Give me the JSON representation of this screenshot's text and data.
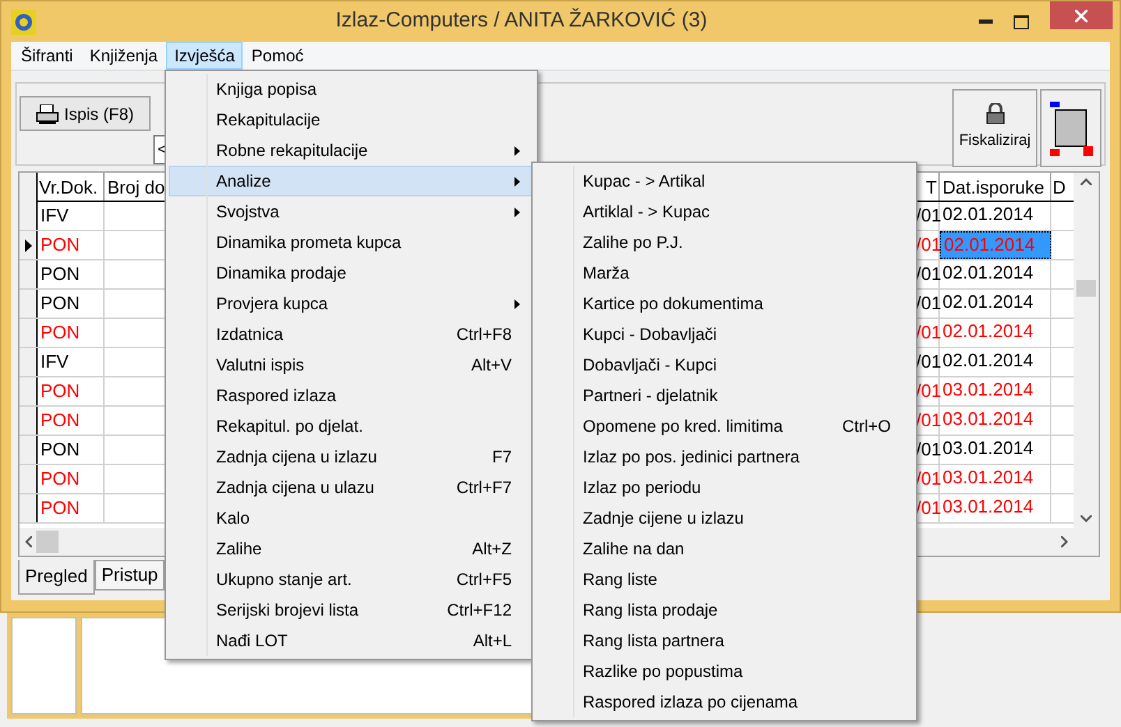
{
  "window": {
    "title": "Izlaz-Computers / ANITA ŽARKOVIĆ (3)"
  },
  "menu_bar": [
    {
      "label": "Šifranti",
      "selected": false
    },
    {
      "label": "Knjiženja",
      "selected": false
    },
    {
      "label": "Izvješća",
      "selected": true
    },
    {
      "label": "Pomoć",
      "selected": false
    }
  ],
  "toolbar": {
    "print_button": "Ispis (F8)",
    "field_value": "<",
    "fiscal_button": "Fiskaliziraj"
  },
  "table": {
    "columns": [
      "Vr.Dok.",
      "Broj do",
      "T",
      "Dat.isporuke",
      "D"
    ],
    "rows": [
      {
        "current": false,
        "red": false,
        "selected_date": false,
        "cells": [
          "IFV",
          "",
          "/01",
          "02.01.2014"
        ]
      },
      {
        "current": true,
        "red": true,
        "selected_date": true,
        "cells": [
          "PON",
          "",
          "/01",
          "02.01.2014"
        ]
      },
      {
        "current": false,
        "red": false,
        "selected_date": false,
        "cells": [
          "PON",
          "",
          "/01",
          "02.01.2014"
        ]
      },
      {
        "current": false,
        "red": false,
        "selected_date": false,
        "cells": [
          "PON",
          "",
          "/01",
          "02.01.2014"
        ]
      },
      {
        "current": false,
        "red": true,
        "selected_date": false,
        "cells": [
          "PON",
          "",
          "/01",
          "02.01.2014"
        ]
      },
      {
        "current": false,
        "red": false,
        "selected_date": false,
        "cells": [
          "IFV",
          "",
          "/01",
          "02.01.2014"
        ]
      },
      {
        "current": false,
        "red": true,
        "selected_date": false,
        "cells": [
          "PON",
          "",
          "/01",
          "03.01.2014"
        ]
      },
      {
        "current": false,
        "red": true,
        "selected_date": false,
        "cells": [
          "PON",
          "",
          "/01",
          "03.01.2014"
        ]
      },
      {
        "current": false,
        "red": false,
        "selected_date": false,
        "cells": [
          "PON",
          "",
          "/01",
          "03.01.2014"
        ]
      },
      {
        "current": false,
        "red": true,
        "selected_date": false,
        "cells": [
          "PON",
          "",
          "/01",
          "03.01.2014"
        ]
      },
      {
        "current": false,
        "red": true,
        "selected_date": false,
        "cells": [
          "PON",
          "",
          "/01",
          "03.01.2014"
        ]
      }
    ]
  },
  "tabs": [
    {
      "label": "Pregled",
      "selected": true
    },
    {
      "label": "Pristup",
      "selected": false
    }
  ],
  "menu": [
    {
      "label": "Knjiga popisa",
      "submenu": false,
      "selected": false
    },
    {
      "label": "Rekapitulacije",
      "submenu": false,
      "selected": false
    },
    {
      "label": "Robne rekapitulacije",
      "submenu": true,
      "selected": false
    },
    {
      "label": "Analize",
      "submenu": true,
      "selected": true
    },
    {
      "label": "Svojstva",
      "submenu": true,
      "selected": false
    },
    {
      "label": "Dinamika prometa kupca",
      "submenu": false,
      "selected": false
    },
    {
      "label": "Dinamika prodaje",
      "submenu": false,
      "selected": false
    },
    {
      "label": "Provjera kupca",
      "submenu": true,
      "selected": false
    },
    {
      "label": "Izdatnica",
      "shortcut": "Ctrl+F8",
      "submenu": false,
      "selected": false
    },
    {
      "label": "Valutni ispis",
      "shortcut": "Alt+V",
      "submenu": false,
      "selected": false
    },
    {
      "label": "Raspored izlaza",
      "submenu": false,
      "selected": false
    },
    {
      "label": "Rekapitul. po djelat.",
      "submenu": false,
      "selected": false
    },
    {
      "label": "Zadnja cijena u izlazu",
      "shortcut": "F7",
      "submenu": false,
      "selected": false
    },
    {
      "label": "Zadnja cijena u ulazu",
      "shortcut": "Ctrl+F7",
      "submenu": false,
      "selected": false
    },
    {
      "label": "Kalo",
      "submenu": false,
      "selected": false
    },
    {
      "label": "Zalihe",
      "shortcut": "Alt+Z",
      "submenu": false,
      "selected": false
    },
    {
      "label": "Ukupno stanje art.",
      "shortcut": "Ctrl+F5",
      "submenu": false,
      "selected": false
    },
    {
      "label": "Serijski brojevi lista",
      "shortcut": "Ctrl+F12",
      "submenu": false,
      "selected": false
    },
    {
      "label": "Nađi LOT",
      "shortcut": "Alt+L",
      "submenu": false,
      "selected": false
    }
  ],
  "submenu": [
    {
      "label": "Kupac - > Artikal"
    },
    {
      "label": "Artiklal - > Kupac"
    },
    {
      "label": "Zalihe po P.J."
    },
    {
      "label": "Marža"
    },
    {
      "label": "Kartice po dokumentima"
    },
    {
      "label": "Kupci - Dobavljači"
    },
    {
      "label": "Dobavljači - Kupci"
    },
    {
      "label": "Partneri - djelatnik"
    },
    {
      "label": "Opomene po kred. limitima",
      "shortcut": "Ctrl+O"
    },
    {
      "label": "Izlaz po pos. jedinici partnera"
    },
    {
      "label": "Izlaz po periodu"
    },
    {
      "label": "Zadnje cijene u izlazu"
    },
    {
      "label": "Zalihe na dan"
    },
    {
      "label": "Rang liste"
    },
    {
      "label": "Rang lista prodaje"
    },
    {
      "label": "Rang lista partnera"
    },
    {
      "label": "Razlike po popustima"
    },
    {
      "label": "Raspored izlaza po cijenama"
    }
  ]
}
